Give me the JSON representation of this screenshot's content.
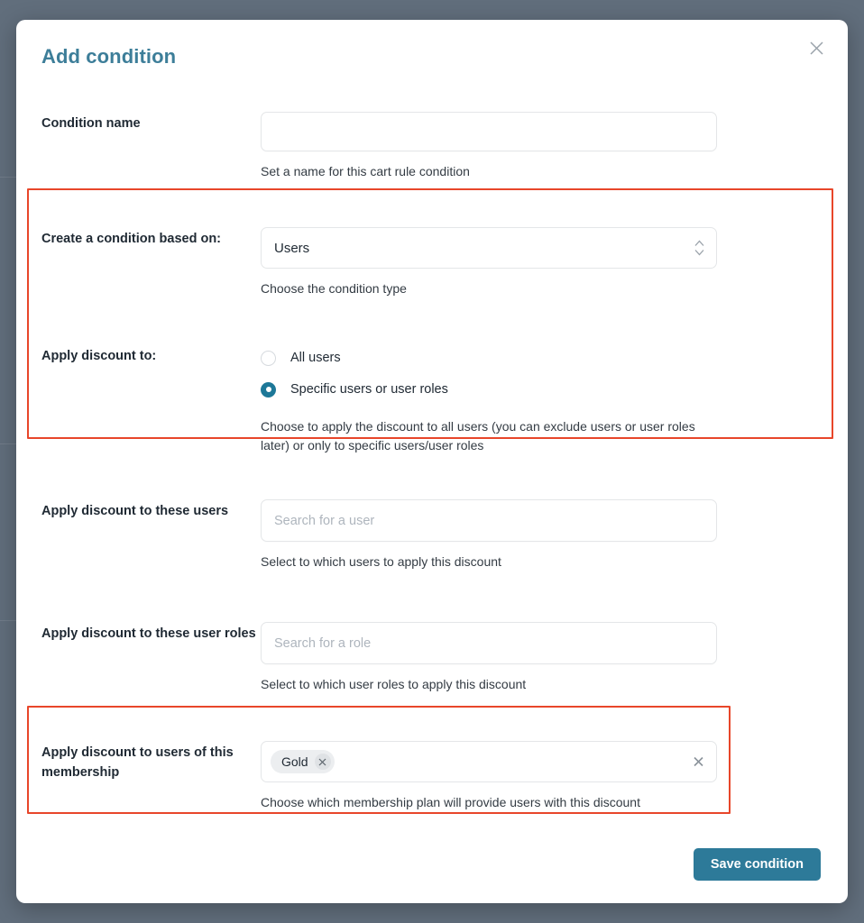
{
  "backdrop": {
    "color": "#616e7c"
  },
  "dialog": {
    "title": "Add condition",
    "close_icon": "close-icon",
    "accent_color": "#3d7e99",
    "highlight_color": "#e8462a"
  },
  "fields": {
    "condition_name": {
      "label": "Condition name",
      "value": "",
      "placeholder": "",
      "helper": "Set a name for this cart rule condition"
    },
    "condition_based_on": {
      "label": "Create a condition based on:",
      "selected": "Users",
      "helper": "Choose the condition type",
      "chevron_icon": "chevron-up-down-icon"
    },
    "apply_discount_to": {
      "label": "Apply discount to:",
      "options": [
        {
          "label": "All users",
          "selected": false
        },
        {
          "label": "Specific users or user roles",
          "selected": true
        }
      ],
      "helper": "Choose to apply the discount to all users (you can exclude users or user roles later) or only to specific users/user roles"
    },
    "apply_to_users": {
      "label": "Apply discount to these users",
      "value": "",
      "placeholder": "Search for a user",
      "helper": "Select to which users to apply this discount"
    },
    "apply_to_user_roles": {
      "label": "Apply discount to these user roles",
      "value": "",
      "placeholder": "Search for a role",
      "helper": "Select to which user roles to apply this discount"
    },
    "apply_to_membership": {
      "label": "Apply discount to users of this membership",
      "tags": [
        {
          "label": "Gold",
          "remove_icon": "chip-remove-icon"
        }
      ],
      "clear_icon": "clear-icon",
      "helper": "Choose which membership plan will provide users with this discount"
    }
  },
  "footer": {
    "save_label": "Save condition"
  }
}
